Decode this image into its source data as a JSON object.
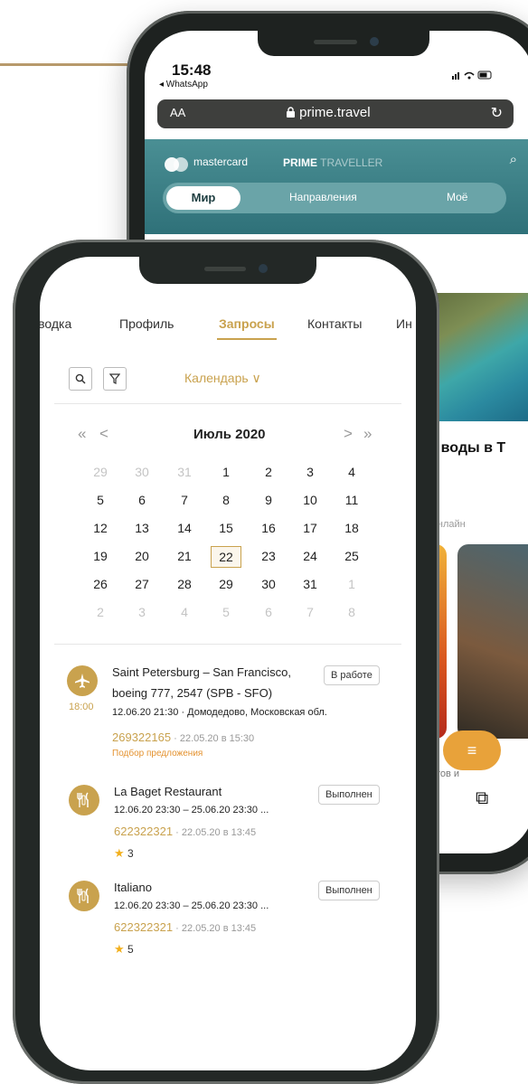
{
  "back_phone": {
    "status": {
      "time": "15:48",
      "back_app": "◂ WhatsApp"
    },
    "browser": {
      "text_size": "AA",
      "url": "prime.travel"
    },
    "header": {
      "mastercard": "mastercard",
      "brand_bold": "PRIME",
      "brand_light": "TRAVELLER",
      "tabs": [
        "Мир",
        "Направления",
        "Моё"
      ]
    },
    "content": {
      "heading_fragment": "и у воды в Т",
      "subtext_fragment": "у и онлайн",
      "bottom_fragment": "ертов и"
    }
  },
  "front_phone": {
    "nav": {
      "tabs": [
        "Сводка",
        "Профиль",
        "Запросы",
        "Контакты",
        "Ин"
      ],
      "active": "Запросы"
    },
    "toolbar": {
      "calendar_label": "Календарь ∨"
    },
    "calendar": {
      "month": "Июль 2020",
      "prev_year": "«",
      "prev_month": "<",
      "next_month": ">",
      "next_year": "»",
      "selected_day": "22",
      "weeks": [
        [
          "29",
          "30",
          "31",
          "1",
          "2",
          "3",
          "4"
        ],
        [
          "5",
          "6",
          "7",
          "8",
          "9",
          "10",
          "11"
        ],
        [
          "12",
          "13",
          "14",
          "15",
          "16",
          "17",
          "18"
        ],
        [
          "19",
          "20",
          "21",
          "22",
          "23",
          "24",
          "25"
        ],
        [
          "26",
          "27",
          "28",
          "29",
          "30",
          "31",
          "1"
        ],
        [
          "2",
          "3",
          "4",
          "5",
          "6",
          "7",
          "8"
        ]
      ]
    },
    "requests": [
      {
        "time": "18:00",
        "title_line1": "Saint Petersburg – San Francisco,",
        "title_line2": "boeing 777, 2547 (SPB - SFO)",
        "details": "12.06.20  21:30 · Домодедово, Московская обл.",
        "number": "269322165",
        "created": " · 22.05.20 в 15:30",
        "note": "Подбор предложения",
        "status": "В работе"
      },
      {
        "title_line1": "La Baget Restaurant",
        "details": "12.06.20  23:30 – 25.06.20  23:30 ...",
        "number": "622322321",
        "created": " · 22.05.20 в 13:45",
        "rating": "3",
        "status": "Выполнен"
      },
      {
        "title_line1": "Italiano",
        "details": "12.06.20  23:30 – 25.06.20  23:30 ...",
        "number": "622322321",
        "created": " · 22.05.20 в 13:45",
        "rating": "5",
        "status": "Выполнен"
      }
    ]
  }
}
